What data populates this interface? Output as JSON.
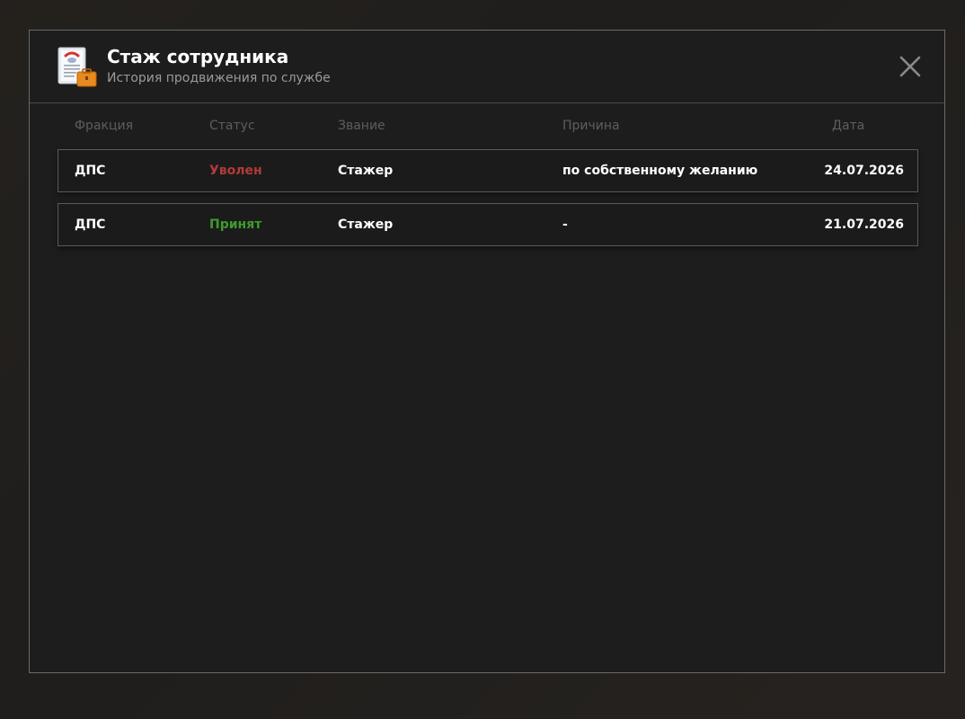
{
  "header": {
    "title": "Стаж сотрудника",
    "subtitle": "История продвижения по службе"
  },
  "table": {
    "columns": [
      "Фракция",
      "Статус",
      "Звание",
      "Причина",
      "Дата"
    ],
    "rows": [
      {
        "faction": "ДПС",
        "status": "Уволен",
        "status_color": "#b33a3a",
        "rank": "Стажер",
        "reason": "по собственному желанию",
        "date": "24.07.2026"
      },
      {
        "faction": "ДПС",
        "status": "Принят",
        "status_color": "#3f9a2e",
        "rank": "Стажер",
        "reason": "-",
        "date": "21.07.2026"
      }
    ]
  },
  "icons": {
    "header_icon": "document-briefcase-icon",
    "close": "close-icon"
  }
}
